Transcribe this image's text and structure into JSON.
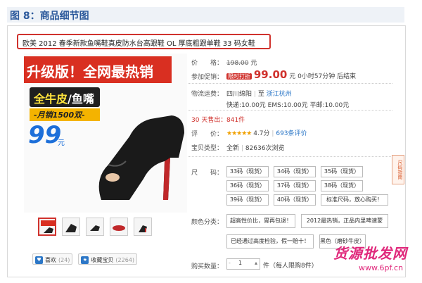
{
  "figure_title": "图 8：商品细节图",
  "product_title": "欧美 2012 春季新款鱼嘴鞋真皮防水台高跟鞋 OL 厚底粗跟单鞋 33 码女鞋",
  "image_promo": {
    "banner": "升级版！全网最热销",
    "material": "全牛皮",
    "style": "/鱼嘴",
    "sales": "-月销1500双-",
    "price": "99",
    "unit": "元"
  },
  "thumbnails": [
    "thumb-1",
    "thumb-2",
    "thumb-3",
    "thumb-4",
    "thumb-5"
  ],
  "social": {
    "like_label": "喜欢",
    "like_count": "(24)",
    "fav_label": "收藏宝贝",
    "fav_count": "(2264)"
  },
  "details": {
    "price_label": "价　　格：",
    "price_value": "198.00",
    "price_unit": "元",
    "promo_label": "参加促销：",
    "promo_tag": "限时打折",
    "promo_price": "99.00",
    "promo_unit": "元",
    "promo_time": "0小时57分钟 后结束",
    "shipping_label": "物流运费：",
    "shipping_from": "四川绵阳",
    "shipping_to": "浙江杭州",
    "shipping_fees": "快递:10.00元  EMS:10.00元  平邮:10.00元",
    "sales_label": "30 天售出：",
    "sales_count": "841件",
    "rating_label": "评　　价：",
    "rating_stars": "★★★★★",
    "rating_score": "4.7分",
    "rating_count": "693条评价",
    "type_label": "宝贝类型：",
    "type_value": "全新",
    "views": "82636次浏览",
    "size_label": "尺　　码：",
    "sizes": [
      "33码（现货）",
      "34码（现货）",
      "35码（现货）",
      "36码（现货）",
      "37码（现货）",
      "38码（现货）",
      "39码（现货）",
      "40码（现货）",
      "标准尺码，放心购买！"
    ],
    "color_label": "颜色分类：",
    "colors": [
      "超高性价比，胃再包退！",
      "2012最热销，正品内里啤速蒙",
      "已经通过高度检验，假一赔十！",
      "黑色（磨砂牛皮）"
    ],
    "qty_label": "购买数量：",
    "qty_value": "1",
    "qty_note": "件（每人限购8件）",
    "side_tag": "尺码指南"
  },
  "watermark": {
    "main": "货源批发网",
    "url": "www.6pf.cn"
  },
  "colors": {
    "accent_red": "#d0322d",
    "price_blue": "#1d6fd9",
    "link_blue": "#2c77c7",
    "header_blue": "#2d5a9c"
  }
}
